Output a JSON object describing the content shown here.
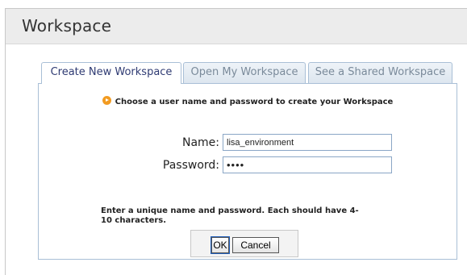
{
  "header": {
    "title": "Workspace"
  },
  "tabs": [
    {
      "label": "Create New Workspace",
      "active": true
    },
    {
      "label": "Open My Workspace",
      "active": false
    },
    {
      "label": "See a Shared Workspace",
      "active": false
    }
  ],
  "form": {
    "instruction": "Choose a user name and password to create your Workspace",
    "name_label": "Name:",
    "name_value": "lisa_environment",
    "password_label": "Password:",
    "password_value": "••••",
    "hint": "Enter a unique name and password. Each should have 4-10 characters."
  },
  "buttons": {
    "ok": "OK",
    "cancel": "Cancel"
  },
  "colors": {
    "accent_icon": "#f29b21",
    "active_tab_text": "#2f3b73",
    "border": "#a9bfd6"
  }
}
